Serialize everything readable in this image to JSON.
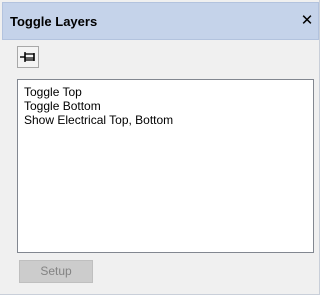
{
  "window": {
    "title": "Toggle Layers",
    "close_symbol": "✕"
  },
  "toolbar": {
    "pin_icon": "pin-icon"
  },
  "layers_list": {
    "items": [
      "Toggle Top",
      "Toggle Bottom",
      "Show Electrical Top, Bottom"
    ]
  },
  "buttons": {
    "setup_label": "Setup",
    "setup_enabled": false
  },
  "colors": {
    "title_bar": "#c5d3ea",
    "panel_background": "#f0f0f0",
    "list_background": "#ffffff",
    "disabled_button": "#cccccc",
    "disabled_text": "#838383"
  }
}
